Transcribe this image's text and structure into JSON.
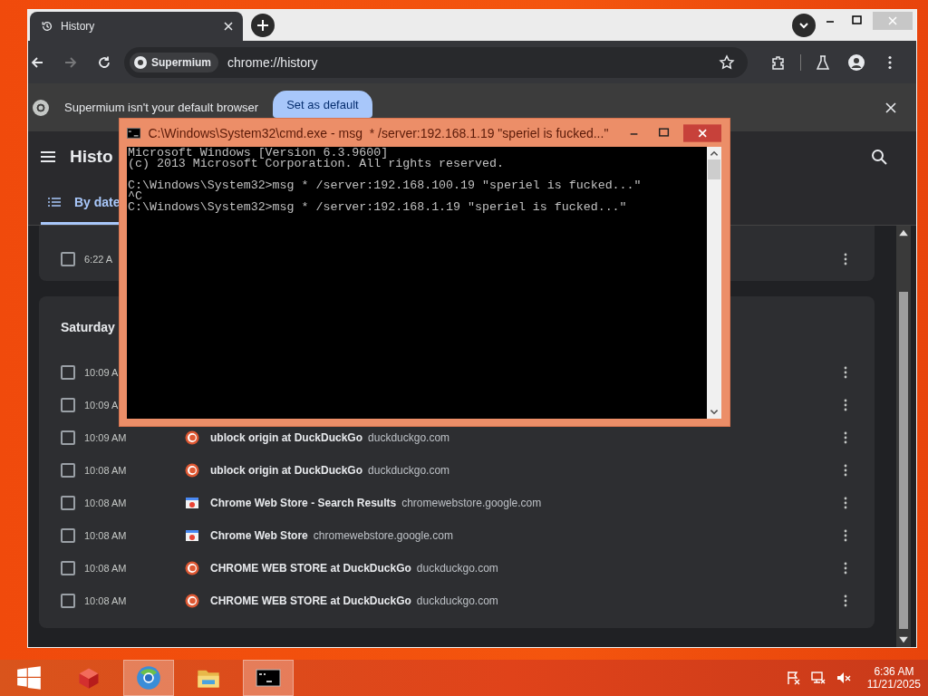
{
  "browser": {
    "tab": {
      "label": "History"
    },
    "toolbar": {
      "chip": "Supermium",
      "url": "chrome://history"
    },
    "infobar": {
      "message": "Supermium isn't your default browser",
      "button": "Set as default"
    },
    "page": {
      "title": "Histo",
      "tabs": [
        {
          "label": "By date",
          "selected": true
        }
      ],
      "groups": [
        {
          "rows": [
            {
              "time": "6:22 A",
              "checked": false
            }
          ]
        },
        {
          "heading": "Saturday",
          "rows": [
            {
              "time": "10:09 A",
              "checked": false
            },
            {
              "time": "10:09 A",
              "checked": false
            },
            {
              "time": "10:09 AM",
              "checked": false,
              "kind": "duckduckgo",
              "title": "ublock origin at DuckDuckGo",
              "domain": "duckduckgo.com"
            },
            {
              "time": "10:08 AM",
              "checked": false,
              "kind": "duckduckgo",
              "title": "ublock origin at DuckDuckGo",
              "domain": "duckduckgo.com"
            },
            {
              "time": "10:08 AM",
              "checked": false,
              "kind": "webstore",
              "title": "Chrome Web Store - Search Results",
              "domain": "chromewebstore.google.com"
            },
            {
              "time": "10:08 AM",
              "checked": false,
              "kind": "webstore",
              "title": "Chrome Web Store",
              "domain": "chromewebstore.google.com"
            },
            {
              "time": "10:08 AM",
              "checked": false,
              "kind": "duckduckgo",
              "title": "CHROME WEB STORE at DuckDuckGo",
              "domain": "duckduckgo.com"
            },
            {
              "time": "10:08 AM",
              "checked": false,
              "kind": "duckduckgo",
              "title": "CHROME WEB STORE at DuckDuckGo",
              "domain": "duckduckgo.com"
            }
          ]
        }
      ]
    }
  },
  "cmd_window": {
    "title": "C:\\Windows\\System32\\cmd.exe - msg  * /server:192.168.1.19 \"speriel is fucked...\"",
    "blocks": [
      [
        "Microsoft Windows [Version 6.3.9600]",
        "(c) 2013 Microsoft Corporation. All rights reserved."
      ],
      [
        "C:\\Windows\\System32>msg * /server:192.168.100.19 \"speriel is fucked...\"",
        "^C",
        "C:\\Windows\\System32>msg * /server:192.168.1.19 \"speriel is fucked...\""
      ]
    ]
  },
  "taskbar": {
    "apps": [
      {
        "kind": "start",
        "active": false
      },
      {
        "kind": "cube",
        "active": false
      },
      {
        "kind": "globe",
        "active": true
      },
      {
        "kind": "folder",
        "active": false
      },
      {
        "kind": "terminal",
        "active": true
      }
    ],
    "time": "6:36 AM",
    "date": "11/21/2025"
  }
}
